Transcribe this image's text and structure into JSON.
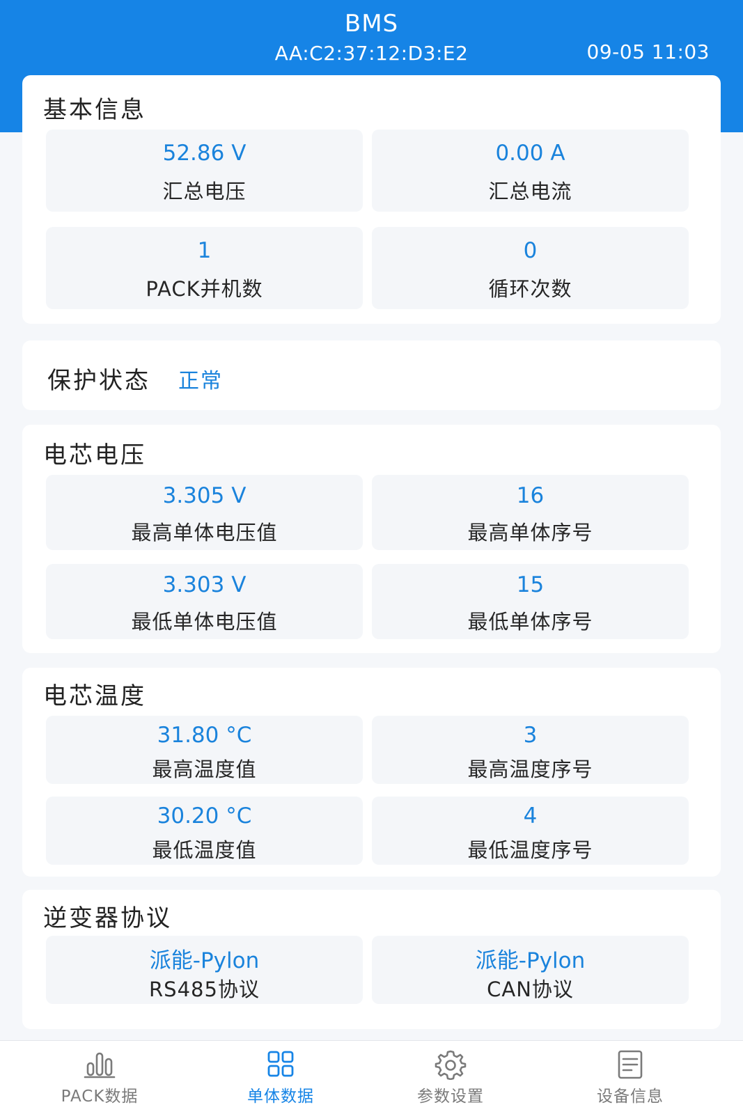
{
  "header": {
    "title": "BMS",
    "mac": "AA:C2:37:12:D3:E2",
    "time": "09-05 11:03"
  },
  "basic_info": {
    "title": "基本信息",
    "tiles": [
      {
        "value": "52.86 V",
        "label": "汇总电压"
      },
      {
        "value": "0.00 A",
        "label": "汇总电流"
      },
      {
        "value": "1",
        "label": "PACK并机数"
      },
      {
        "value": "0",
        "label": "循环次数"
      }
    ]
  },
  "protection": {
    "label": "保护状态",
    "value": "正常"
  },
  "cell_voltage": {
    "title": "电芯电压",
    "tiles": [
      {
        "value": "3.305 V",
        "label": "最高单体电压值"
      },
      {
        "value": "16",
        "label": "最高单体序号"
      },
      {
        "value": "3.303 V",
        "label": "最低单体电压值"
      },
      {
        "value": "15",
        "label": "最低单体序号"
      }
    ]
  },
  "cell_temperature": {
    "title": "电芯温度",
    "tiles": [
      {
        "value": "31.80 °C",
        "label": "最高温度值"
      },
      {
        "value": "3",
        "label": "最高温度序号"
      },
      {
        "value": "30.20 °C",
        "label": "最低温度值"
      },
      {
        "value": "4",
        "label": "最低温度序号"
      }
    ]
  },
  "inverter_protocol": {
    "title": "逆变器协议",
    "tiles": [
      {
        "value": "派能-Pylon",
        "label": "RS485协议"
      },
      {
        "value": "派能-Pylon",
        "label": "CAN协议"
      }
    ]
  },
  "tabbar": {
    "active_index": 1,
    "accent": "#1684e6",
    "items": [
      {
        "label": "PACK数据",
        "icon": "bar-chart-icon"
      },
      {
        "label": "单体数据",
        "icon": "grid-icon"
      },
      {
        "label": "参数设置",
        "icon": "gear-icon"
      },
      {
        "label": "设备信息",
        "icon": "document-icon"
      }
    ]
  }
}
